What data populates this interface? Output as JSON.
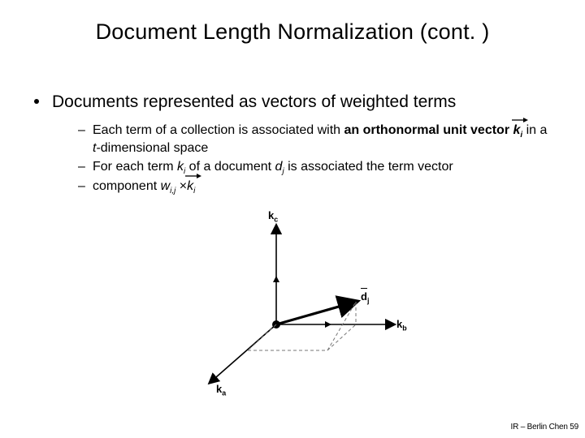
{
  "title": "Document Length Normalization (cont. )",
  "bullet": "Documents represented as vectors of weighted terms",
  "sub1_pre": "Each term of a collection is associated with ",
  "sub1_bold": "an orthonormal unit vector ",
  "sub1_post1": " in a ",
  "sub1_t": "t",
  "sub1_post2": "-dimensional space",
  "sub2_pre": "For each term ",
  "sub2_mid": " of a document ",
  "sub2_post": " is associated the term vector",
  "sub3_pre": "component ",
  "sub3_times": "×",
  "k": "k",
  "d": "d",
  "w": "w",
  "ki": "i",
  "kj": "j",
  "kij": "i,j",
  "fig": {
    "ka": "a",
    "kb": "b",
    "kc": "c",
    "dj": "j"
  },
  "footer": "IR – Berlin Chen 59"
}
